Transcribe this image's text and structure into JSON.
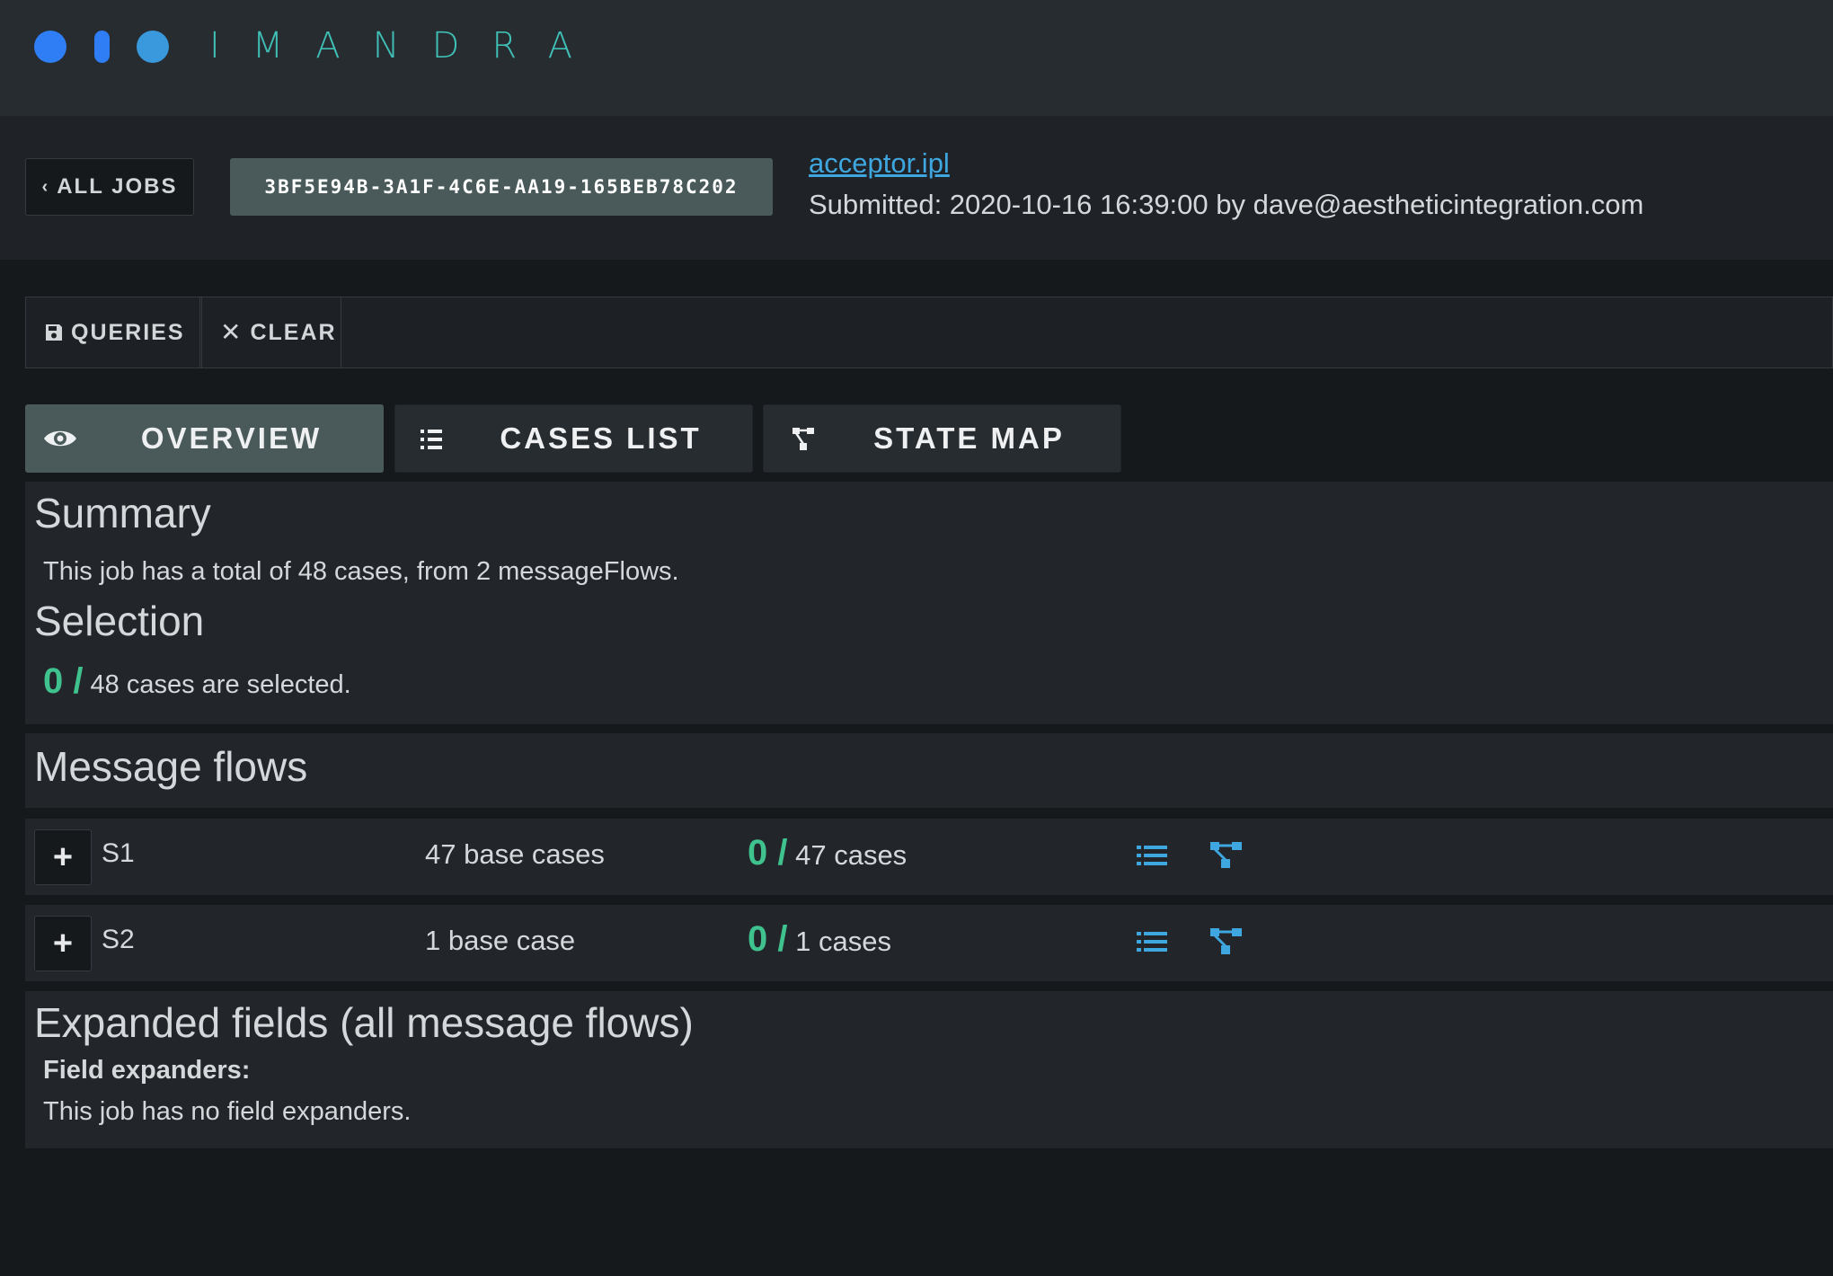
{
  "app": {
    "brand": "IMANDRA"
  },
  "job": {
    "back_label": "ALL JOBS",
    "id": "3BF5E94B-3A1F-4C6E-AA19-165BEB78C202",
    "file": "acceptor.ipl",
    "submitted": "Submitted: 2020-10-16 16:39:00 by dave@aestheticintegration.com"
  },
  "toolbar": {
    "queries_label": "QUERIES",
    "clear_label": "CLEAR"
  },
  "tabs": [
    {
      "label": "OVERVIEW",
      "icon": "eye-icon",
      "active": true
    },
    {
      "label": "CASES LIST",
      "icon": "list-icon",
      "active": false
    },
    {
      "label": "STATE MAP",
      "icon": "state-map-icon",
      "active": false
    }
  ],
  "summary": {
    "title": "Summary",
    "text": "This job has a total of 48 cases, from 2 messageFlows."
  },
  "selection": {
    "title": "Selection",
    "count": "0 /",
    "text": "48 cases are selected."
  },
  "flows": {
    "title": "Message flows",
    "rows": [
      {
        "name": "S1",
        "base": "47 base cases",
        "count": "0 /",
        "total": "47 cases"
      },
      {
        "name": "S2",
        "base": "1 base case",
        "count": "0 /",
        "total": "1 cases"
      }
    ]
  },
  "expanded": {
    "title": "Expanded fields (all message flows)",
    "label": "Field expanders:",
    "text": "This job has no field expanders."
  },
  "colors": {
    "accent_green": "#3fc28e",
    "accent_blue": "#3fa7e0",
    "brand_teal": "#3fbfb5",
    "logo_blue": "#2f7ef5",
    "active_tab": "#4a5a5a"
  }
}
